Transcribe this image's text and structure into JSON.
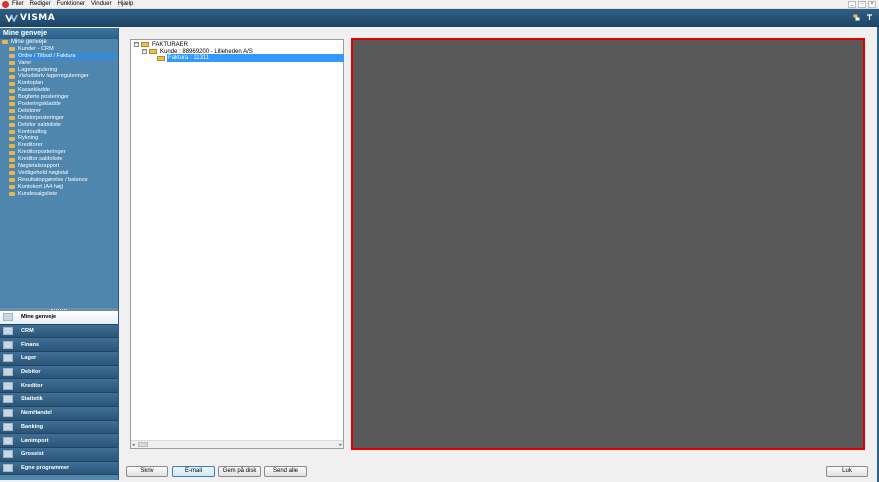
{
  "menu": {
    "items": [
      "Filer",
      "Rediger",
      "Funktioner",
      "Vinduer",
      "Hjælp"
    ],
    "window_controls": [
      "_",
      "▫",
      "×"
    ]
  },
  "header": {
    "logo_text": "VISMA",
    "icons": [
      "swap-icon",
      "help-icon"
    ]
  },
  "sidebar": {
    "title": "Mine genveje",
    "root_label": "Mine genveje",
    "shortcuts": [
      "Kunder - CRM",
      "Ordre / Tilbud / Faktura",
      "Varer",
      "Lagerregulering",
      "Vis/udskriv lagerreguleringer",
      "Kontoplan",
      "Kassekladde",
      "Bogførte posteringer",
      "Posteringskladde",
      "Debitorer",
      "Debitorposteringer",
      "Debitor saldoliste",
      "Kontoudtog",
      "Rykning",
      "Kreditorer",
      "Kreditorposteringer",
      "Kreditor saldoliste",
      "Nøgletalsrapport",
      "Vedligehold nøgletal",
      "Resultatopgørelse / balance",
      "Kontokort (A4 høj)",
      "Kundesalgsliste"
    ],
    "selected_index": 1,
    "nav": [
      "Mine genveje",
      "CRM",
      "Finans",
      "Lager",
      "Debitor",
      "Kreditor",
      "Statistik",
      "NemHandel",
      "Banking",
      "Lønimport",
      "Grossist",
      "Egne programmer"
    ],
    "nav_active_index": 0
  },
  "tree": {
    "root": "FAKTURAER",
    "customer": "Kunde : 88969200 - Lilleheden A/S",
    "invoice": "Faktura : 11311"
  },
  "buttons": {
    "print": "Skriv",
    "email": "E-mail",
    "save": "Gem på disk",
    "send_all": "Send alle",
    "close": "Luk"
  },
  "colors": {
    "header_blue": "#1c4566",
    "sidebar_blue": "#4f86ad",
    "selection": "#3399ff",
    "preview_bg": "#595959",
    "preview_border": "#e00000"
  }
}
